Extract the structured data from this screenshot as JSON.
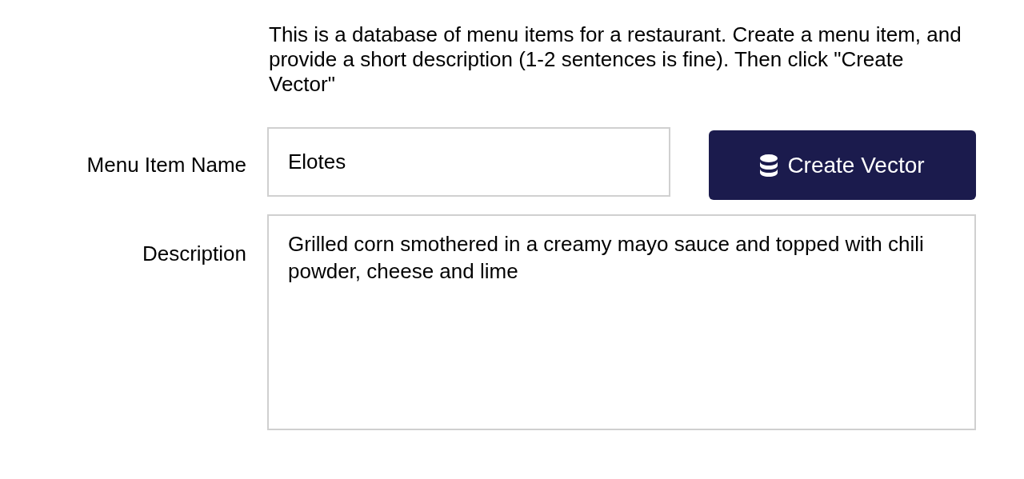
{
  "intro": "This is a database of menu items for a restaurant. Create a menu item, and provide a short description (1-2 sentences is fine). Then click \"Create Vector\"",
  "fields": [
    {
      "kind": "input",
      "label": "Menu Item Name",
      "value": "Elotes"
    },
    {
      "kind": "textarea",
      "label": "Description",
      "value": "Grilled corn smothered in a creamy mayo sauce and topped with chili powder, cheese and lime"
    }
  ],
  "button": {
    "label": "Create Vector"
  }
}
